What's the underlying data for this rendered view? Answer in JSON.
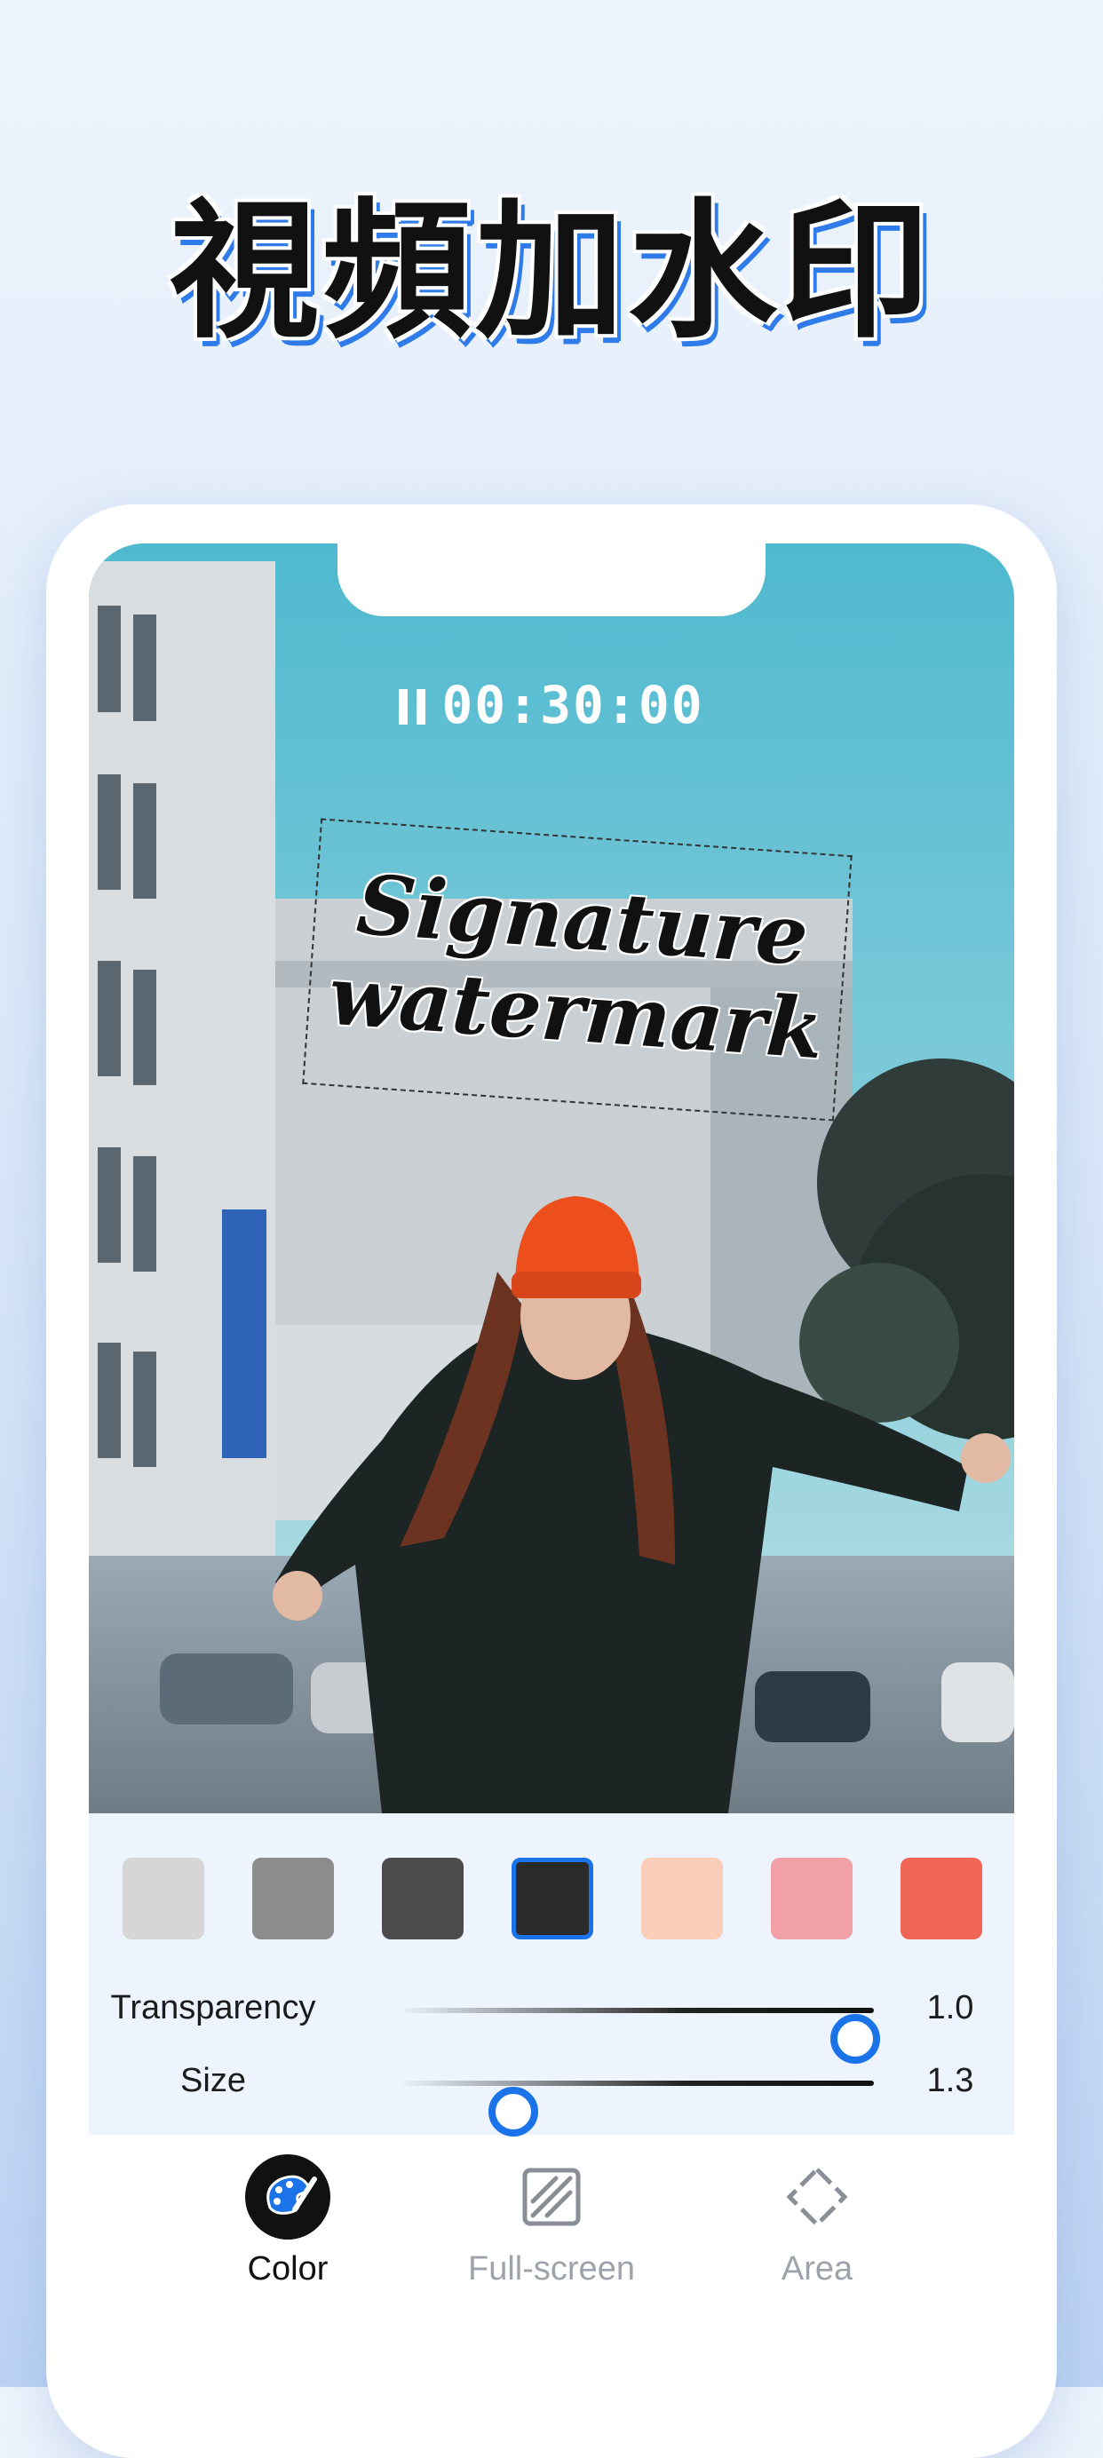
{
  "headline": "視頻加水印",
  "player": {
    "timer": "00:30:00",
    "watermark_text_line1": "Signature",
    "watermark_text_line2": "watermark"
  },
  "colors": {
    "accent": "#1a73e8",
    "swatches": [
      "#d6d6d6",
      "#8c8c8c",
      "#4b4b4b",
      "#2a2a2a",
      "#facdb8",
      "#f1a0a5",
      "#ef6655"
    ],
    "selected_index": 3
  },
  "sliders": {
    "transparency": {
      "label": "Transparency",
      "value": "1.0",
      "position_fraction": 0.96
    },
    "size": {
      "label": "Size",
      "value": "1.3",
      "position_fraction": 0.24
    }
  },
  "tabs": [
    {
      "label": "Color",
      "icon": "palette-icon",
      "active": true
    },
    {
      "label": "Full-screen",
      "icon": "diagonal-stripes-icon",
      "active": false
    },
    {
      "label": "Area",
      "icon": "diamond-area-icon",
      "active": false
    }
  ]
}
